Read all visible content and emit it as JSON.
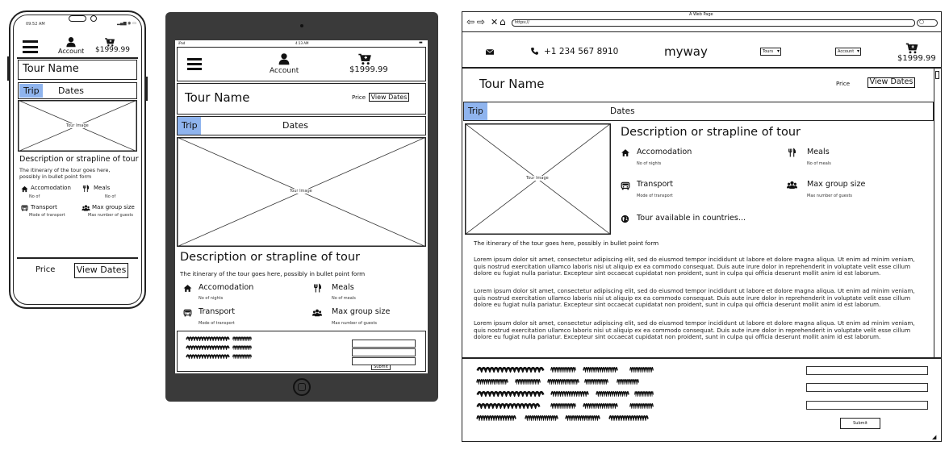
{
  "phone": {
    "time": "09:52 AM",
    "account_label": "Account",
    "cart_price": "$1999.99",
    "tour_name": "Tour Name",
    "tabs": [
      "Trip",
      "Dates"
    ],
    "image_label": "Tour Image",
    "description": "Description or strapline of tour",
    "itinerary": "The itinerary of the tour goes here, possibly in bullet point form",
    "features": [
      {
        "label": "Accomodation",
        "sub": "No of"
      },
      {
        "label": "Meals",
        "sub": "No of"
      },
      {
        "label": "Transport",
        "sub": "Mode of transport"
      },
      {
        "label": "Max group size",
        "sub": "Max number of guests"
      }
    ],
    "price_label": "Price",
    "view_dates": "View Dates"
  },
  "tablet": {
    "status_left": "iPad",
    "status_time": "4:13 AM",
    "account_label": "Account",
    "cart_price": "$1999.99",
    "tour_name": "Tour Name",
    "price_label": "Price",
    "view_dates": "View Dates",
    "tabs": [
      "Trip",
      "Dates"
    ],
    "image_label": "Tour Image",
    "description": "Description or strapline of tour",
    "itinerary": "The itinerary of the tour goes here, possibly in bullet point form",
    "features": [
      {
        "label": "Accomodation",
        "sub": "No of nights"
      },
      {
        "label": "Meals",
        "sub": "No of meals"
      },
      {
        "label": "Transport",
        "sub": "Mode of transport"
      },
      {
        "label": "Max group size",
        "sub": "Max number of guests"
      }
    ],
    "submit": "Submit"
  },
  "browser": {
    "window_title": "A Web Page",
    "url": "https://",
    "phone_number": "+1 234 567 8910",
    "brand": "myway",
    "tours_select": "Tours",
    "account_select": "Account",
    "cart_price": "$1999.99",
    "tour_name": "Tour Name",
    "price_label": "Price",
    "view_dates": "View Dates",
    "tabs": [
      "Trip",
      "Dates"
    ],
    "image_label": "Tour Image",
    "description": "Description or strapline of tour",
    "features": [
      {
        "label": "Accomodation",
        "sub": "No of nights"
      },
      {
        "label": "Meals",
        "sub": "No of meals"
      },
      {
        "label": "Transport",
        "sub": "Mode of transport"
      },
      {
        "label": "Max group size",
        "sub": "Max number of guests"
      },
      {
        "label": "Tour available in countries...",
        "sub": ""
      }
    ],
    "itinerary": "The itinerary of the tour goes here, possibly in bullet point form",
    "lorem": "Lorem ipsum dolor sit amet, consectetur adipiscing elit, sed do eiusmod tempor incididunt ut labore et dolore magna aliqua. Ut enim ad minim veniam, quis nostrud exercitation ullamco laboris nisi ut aliquip ex ea commodo consequat. Duis aute irure dolor in reprehenderit in voluptate velit esse cillum dolore eu fugiat nulla pariatur. Excepteur sint occaecat cupidatat non proident, sunt in culpa qui officia deserunt mollit anim id est laborum.",
    "submit": "Submit"
  },
  "colors": {
    "tab_highlight": "#8fb4ee",
    "tablet_frame": "#3a3a3a"
  }
}
